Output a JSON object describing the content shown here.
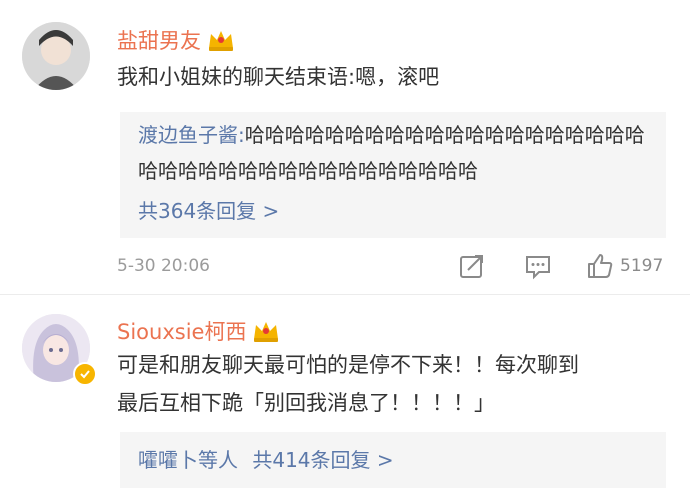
{
  "comments": [
    {
      "user": "盐甜男友",
      "text": "我和小姐妹的聊天结束语:嗯，滚吧",
      "reply_preview": {
        "author": "渡边鱼子酱:",
        "line1": "哈哈哈哈哈哈哈哈哈哈哈哈哈哈哈哈哈哈哈哈",
        "line2": "哈哈哈哈哈哈哈哈哈哈哈哈哈哈哈哈哈"
      },
      "reply_count": "共364条回复 >",
      "date": "5-30 20:06",
      "likes": "5197"
    },
    {
      "user": "Siouxsie柯西",
      "text_line1": "可是和朋友聊天最可怕的是停不下来！！每次聊到",
      "text_line2": "最后互相下跪「别回我消息了！！！！」",
      "repliers": "嚯嚯卜等人",
      "reply_count": "共414条回复 >"
    }
  ],
  "colors": {
    "username": "#eb7350",
    "link": "#5b78a9",
    "reply_bg": "#f5f5f5",
    "meta": "#9b9b9b"
  },
  "icons": [
    "crown-icon",
    "share-icon",
    "comment-icon",
    "like-icon",
    "verified-badge-icon"
  ]
}
